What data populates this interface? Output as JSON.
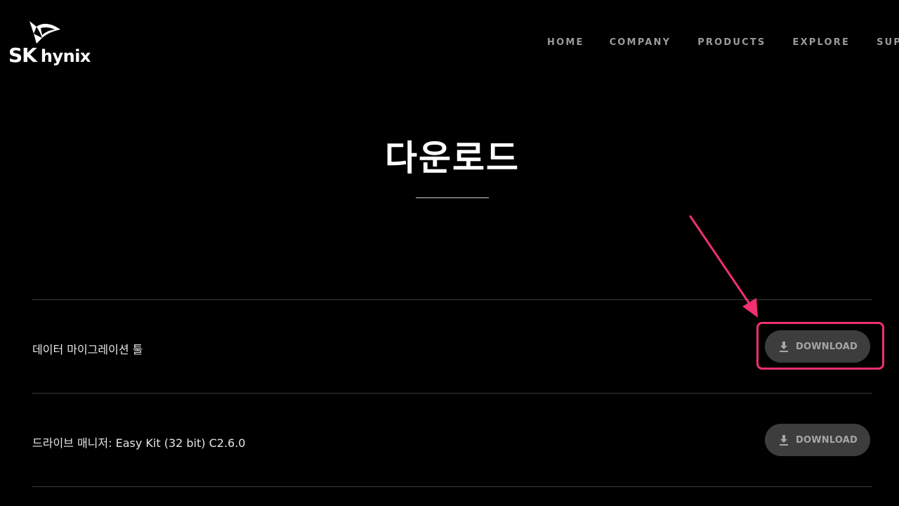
{
  "brand": {
    "logo_sk": "SK",
    "logo_hynix": "hynix",
    "logo_icon": "butterfly-logo-icon"
  },
  "nav": {
    "items": [
      "HOME",
      "COMPANY",
      "PRODUCTS",
      "EXPLORE",
      "SUPPORT"
    ]
  },
  "main": {
    "title": "다운로드"
  },
  "downloads": [
    {
      "label": "데이터 마이그레이션 툴",
      "button_label": "DOWNLOAD",
      "icon": "download-icon"
    },
    {
      "label": "드라이브 매니저: Easy Kit (32 bit) C2.6.0",
      "button_label": "DOWNLOAD",
      "icon": "download-icon"
    }
  ],
  "annotation": {
    "color": "#f0306f",
    "highlight_target": "first download button"
  },
  "colors": {
    "background": "#000000",
    "nav_text": "#9a9a9a",
    "button_bg": "#3d3d3d",
    "button_text": "#a6a6a6"
  }
}
